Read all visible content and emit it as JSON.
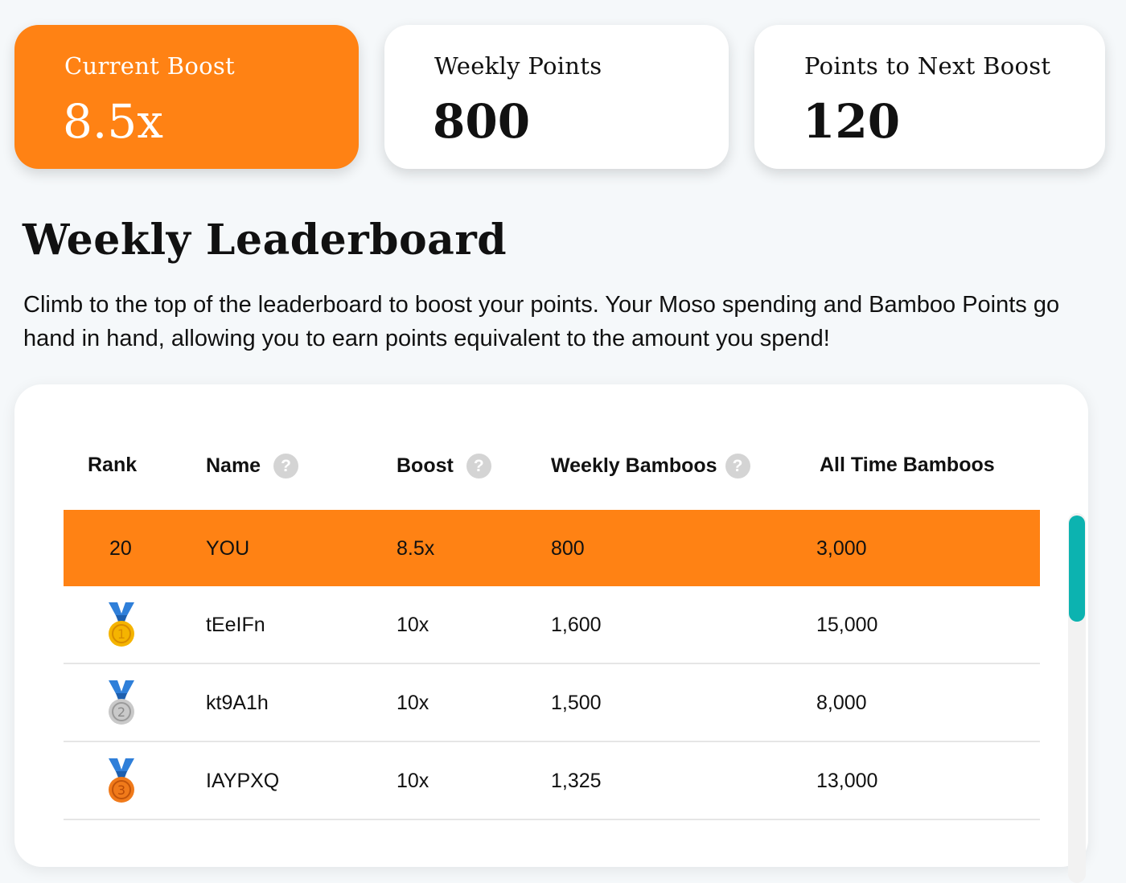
{
  "stats": {
    "current_boost_label": "Current Boost",
    "current_boost_value": "8.5x",
    "weekly_points_label": "Weekly Points",
    "weekly_points_value": "800",
    "next_boost_label": "Points to Next Boost",
    "next_boost_value": "120"
  },
  "section": {
    "title": "Weekly Leaderboard",
    "description": "Climb to the top of the leaderboard to boost your points. Your Moso spending and Bamboo Points go hand in hand, allowing you to earn points equivalent to the amount you spend!"
  },
  "table": {
    "headers": {
      "rank": "Rank",
      "name": "Name",
      "boost": "Boost",
      "weekly": "Weekly Bamboos",
      "all_time": "All Time Bamboos"
    },
    "help_glyph": "?",
    "you_row": {
      "rank": "20",
      "name": "YOU",
      "boost": "8.5x",
      "weekly": "800",
      "all_time": "3,000"
    },
    "rows": [
      {
        "medal": "1",
        "medal_color": "#f5b400",
        "name": "tEeIFn",
        "boost": "10x",
        "weekly": "1,600",
        "all_time": "15,000"
      },
      {
        "medal": "2",
        "medal_color": "#bfbfbf",
        "name": "kt9A1h",
        "boost": "10x",
        "weekly": "1,500",
        "all_time": "8,000"
      },
      {
        "medal": "3",
        "medal_color": "#f07a1a",
        "name": "IAYPXQ",
        "boost": "10x",
        "weekly": "1,325",
        "all_time": "13,000"
      }
    ]
  },
  "colors": {
    "accent": "#ff8214",
    "scrollbar_thumb": "#0cb3b0",
    "ribbon": "#2f7fd9"
  },
  "icons": {
    "help": "question-circle-icon",
    "medal": "medal-icon"
  }
}
